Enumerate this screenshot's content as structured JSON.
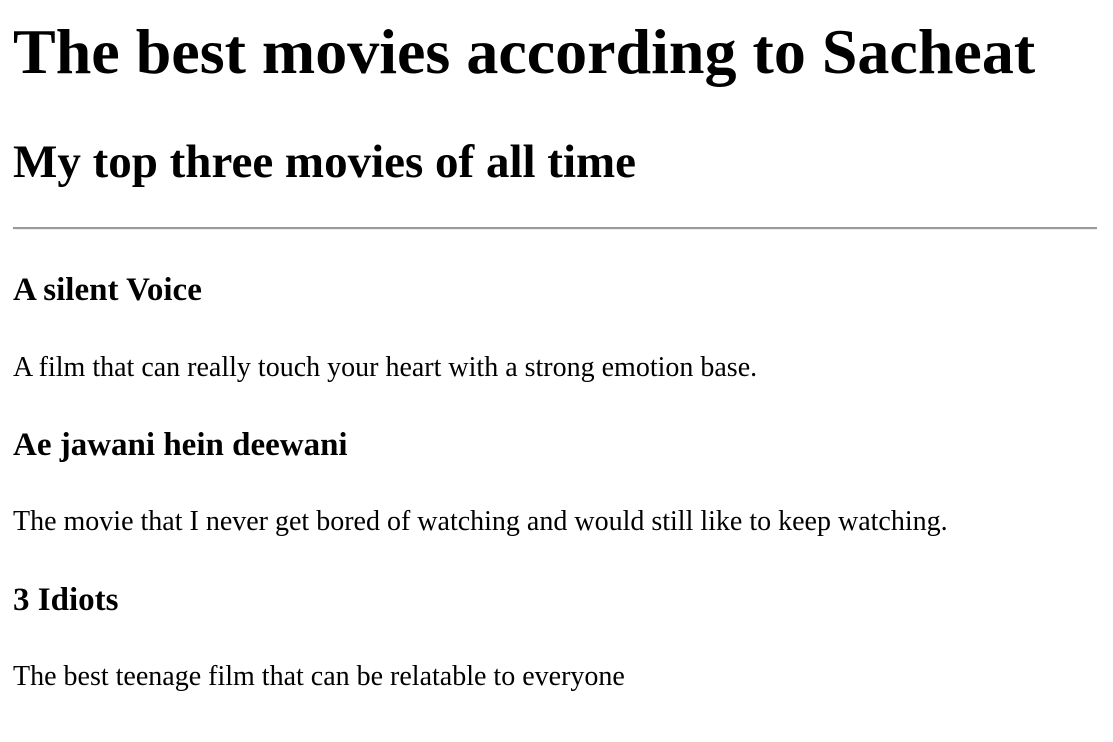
{
  "page": {
    "title": "The best movies according to Sacheat",
    "subtitle": "My top three movies of all time"
  },
  "movies": [
    {
      "title": "A silent Voice",
      "description": "A film that can really touch your heart with a strong emotion base."
    },
    {
      "title": "Ae jawani hein deewani",
      "description": "The movie that I never get bored of watching and would still like to keep watching."
    },
    {
      "title": "3 Idiots",
      "description": "The best teenage film that can be relatable to everyone"
    }
  ]
}
